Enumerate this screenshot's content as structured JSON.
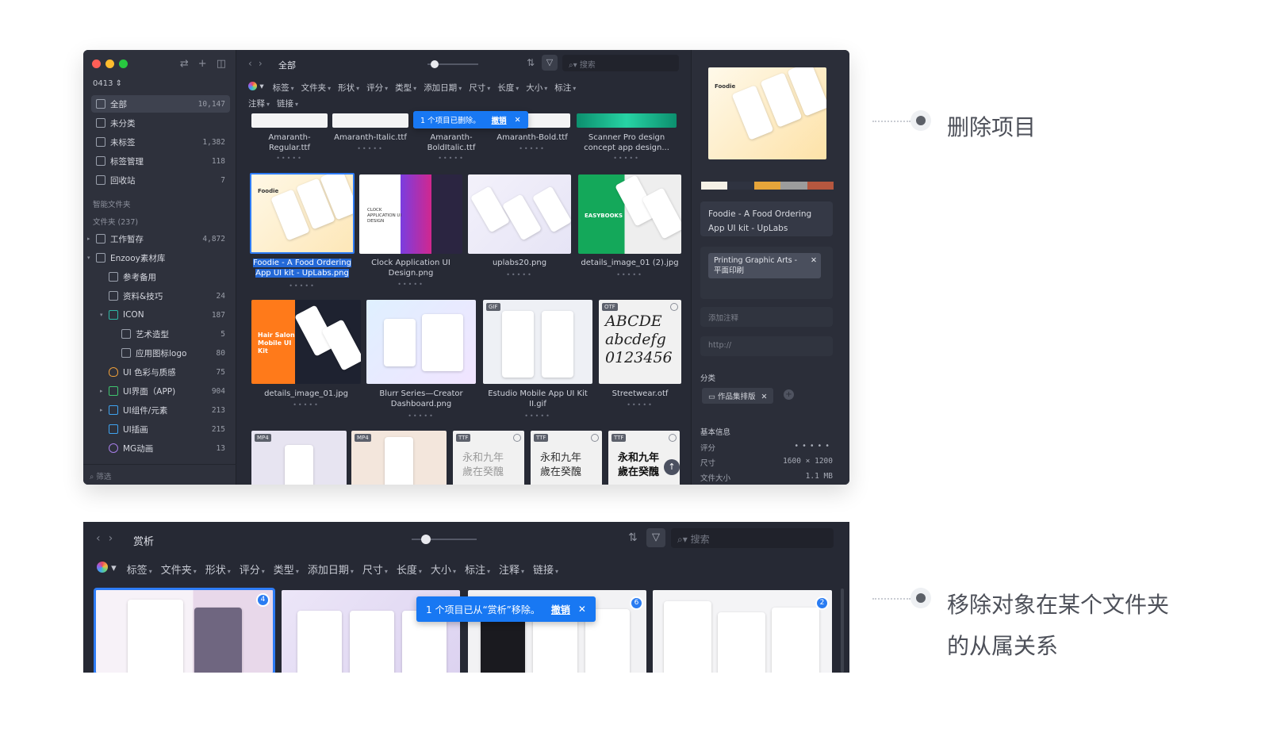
{
  "window1": {
    "sidebar": {
      "library": "0413 ⇕",
      "items": [
        {
          "label": "全部",
          "count": "10,147"
        },
        {
          "label": "未分类",
          "count": ""
        },
        {
          "label": "未标签",
          "count": "1,382"
        },
        {
          "label": "标签管理",
          "count": "118"
        },
        {
          "label": "回收站",
          "count": "7"
        }
      ],
      "smart_folders": "智能文件夹",
      "folders_header": "文件夹 (237)",
      "folders": [
        {
          "label": "工作暂存",
          "count": "4,872"
        },
        {
          "label": "Enzooy素材库",
          "count": ""
        },
        {
          "label": "参考备用",
          "count": ""
        },
        {
          "label": "资料&技巧",
          "count": "24"
        },
        {
          "label": "ICON",
          "count": "187"
        },
        {
          "label": "艺术造型",
          "count": "5"
        },
        {
          "label": "应用图标logo",
          "count": "80"
        },
        {
          "label": "UI 色彩与质感",
          "count": "75"
        },
        {
          "label": "UI界面（APP)",
          "count": "904"
        },
        {
          "label": "UI组件/元素",
          "count": "213"
        },
        {
          "label": "UI插画",
          "count": "215"
        },
        {
          "label": "MG动画",
          "count": "13"
        }
      ],
      "filter_placeholder": "筛选"
    },
    "toolbar": {
      "title": "全部",
      "search_placeholder": "搜索"
    },
    "filters_row1": [
      "标签",
      "文件夹",
      "形状",
      "评分",
      "类型",
      "添加日期",
      "尺寸",
      "长度",
      "大小",
      "标注"
    ],
    "filters_row2": [
      "注释",
      "链接"
    ],
    "toast": {
      "message": "1 个项目已删除。",
      "undo": "撤销"
    },
    "row0": [
      "Amaranth-Regular.ttf",
      "Amaranth-Italic.ttf",
      "Amaranth-BoldItalic.ttf",
      "Amaranth-Bold.ttf",
      "Scanner Pro design concept app design..."
    ],
    "row1": [
      "Foodie - A Food Ordering App UI kit - UpLabs.png",
      "Clock Application UI Design.png",
      "uplabs20.png",
      "details_image_01 (2).jpg"
    ],
    "row2": [
      "details_image_01.jpg",
      "Blurr Series—Creator Dashboard.png",
      "Estudio Mobile App UI Kit II.gif",
      "Streetwear.otf"
    ],
    "thumb_text": {
      "foodie": "Foodie",
      "clock": "CLOCK APPLICATION UI DESIGN",
      "easybooks": "EASYBOOKS",
      "hair": "Hair Salon Mobile UI Kit",
      "font_sample": "ABCDE abcdefg 0123456",
      "cjk": "永和九年 歲在癸醜"
    },
    "badges": {
      "gif": "GIF",
      "otf": "OTF",
      "mp4": "MP4",
      "ttf": "TTF"
    },
    "panel": {
      "palette": [
        "#f5f1e6",
        "#2f3340",
        "#e6a53a",
        "#9c9c9c",
        "#b5573f"
      ],
      "name": "Foodie - A Food Ordering App UI kit - UpLabs",
      "tag": "Printing Graphic Arts - 平面印刷",
      "note_placeholder": "添加注释",
      "url_placeholder": "http://",
      "category_label": "分类",
      "category_value": "作品集排版",
      "basic_info": "基本信息",
      "rating_label": "评分",
      "size_label": "尺寸",
      "size_value": "1600 × 1200",
      "filesize_label": "文件大小",
      "filesize_value": "1.1 MB"
    }
  },
  "window2": {
    "title": "赏析",
    "search_placeholder": "搜索",
    "filters": [
      "标签",
      "文件夹",
      "形状",
      "评分",
      "类型",
      "添加日期",
      "尺寸",
      "长度",
      "大小",
      "标注",
      "注释",
      "链接"
    ],
    "toast": {
      "message": "1 个项目已从“赏析”移除。",
      "undo": "撤销"
    },
    "badges": [
      "4",
      "6",
      "2"
    ]
  },
  "legend": {
    "item1": "删除项目",
    "item2_line1": "移除对象在某个文件夹",
    "item2_line2": "的从属关系"
  }
}
